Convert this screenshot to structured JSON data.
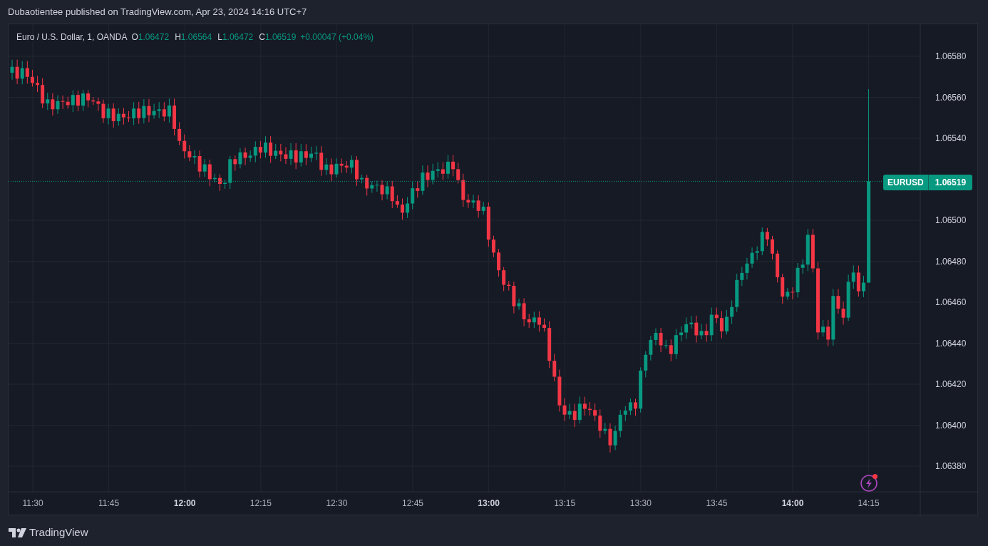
{
  "header": {
    "text": "Dubaotientee published on TradingView.com, Apr 23, 2024 14:16 UTC+7"
  },
  "legend": {
    "symbol": "Euro / U.S. Dollar, 1, OANDA",
    "ohlc": [
      {
        "label": "O",
        "value": "1.06472"
      },
      {
        "label": "H",
        "value": "1.06564"
      },
      {
        "label": "L",
        "value": "1.06472"
      },
      {
        "label": "C",
        "value": "1.06519"
      }
    ],
    "change": "+0.00047 (+0.04%)"
  },
  "price_axis": {
    "ticks": [
      "1.06580",
      "1.06560",
      "1.06540",
      "1.06500",
      "1.06480",
      "1.06460",
      "1.06440",
      "1.06420",
      "1.06400",
      "1.06380"
    ]
  },
  "price_badge": {
    "symbol": "EURUSD",
    "value": "1.06519"
  },
  "time_axis": {
    "ticks": [
      {
        "label": "11:30",
        "major": false
      },
      {
        "label": "11:45",
        "major": false
      },
      {
        "label": "12:00",
        "major": true
      },
      {
        "label": "12:15",
        "major": false
      },
      {
        "label": "12:30",
        "major": false
      },
      {
        "label": "12:45",
        "major": false
      },
      {
        "label": "13:00",
        "major": true
      },
      {
        "label": "13:15",
        "major": false
      },
      {
        "label": "13:30",
        "major": false
      },
      {
        "label": "13:45",
        "major": false
      },
      {
        "label": "14:00",
        "major": true
      },
      {
        "label": "14:15",
        "major": false
      }
    ]
  },
  "footer": {
    "logo_text": "TradingView"
  }
}
